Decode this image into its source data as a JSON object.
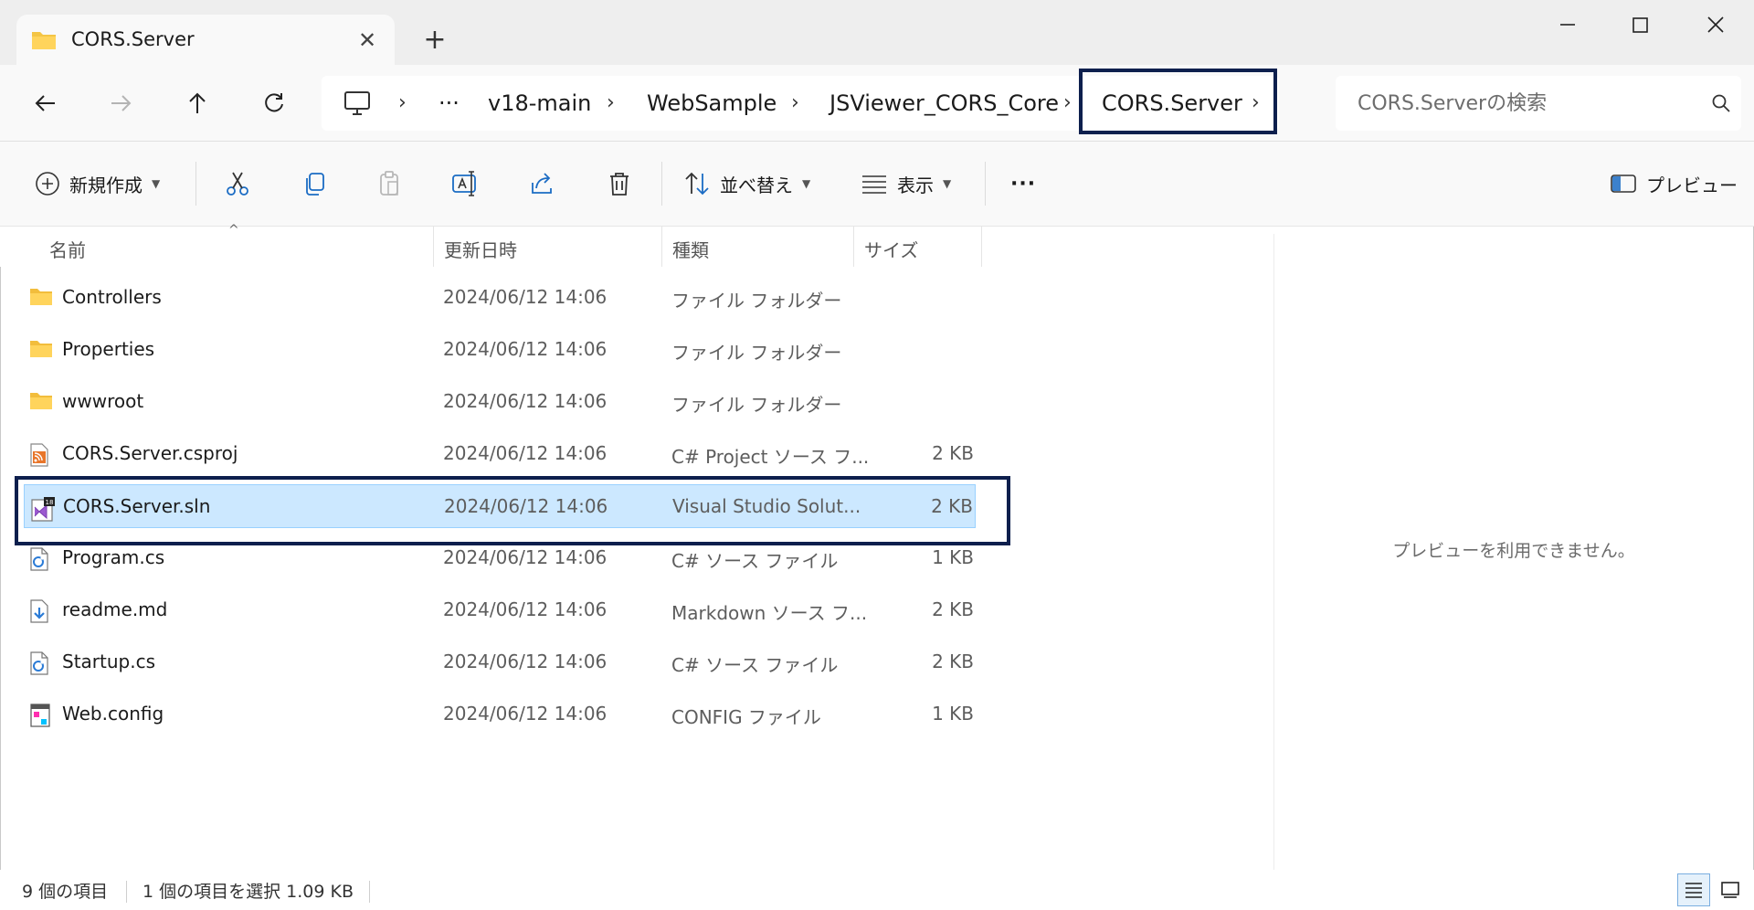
{
  "tab": {
    "title": "CORS.Server",
    "close": "✕",
    "new": "+"
  },
  "address": {
    "overflow": "···",
    "crumbs": [
      "v18-main",
      "WebSample",
      "JSViewer_CORS_Core",
      "CORS.Server"
    ],
    "separator": "›"
  },
  "search": {
    "placeholder": "CORS.Serverの検索"
  },
  "commands": {
    "new": "新規作成",
    "sort": "並べ替え",
    "view": "表示",
    "more": "···",
    "preview": "プレビュー"
  },
  "columns": {
    "name": "名前",
    "date": "更新日時",
    "type": "種類",
    "size": "サイズ",
    "sort_indicator": "^"
  },
  "files": [
    {
      "name": "Controllers",
      "date": "2024/06/12 14:06",
      "type": "ファイル フォルダー",
      "size": "",
      "icon": "folder-icon"
    },
    {
      "name": "Properties",
      "date": "2024/06/12 14:06",
      "type": "ファイル フォルダー",
      "size": "",
      "icon": "folder-icon"
    },
    {
      "name": "wwwroot",
      "date": "2024/06/12 14:06",
      "type": "ファイル フォルダー",
      "size": "",
      "icon": "folder-icon"
    },
    {
      "name": "CORS.Server.csproj",
      "date": "2024/06/12 14:06",
      "type": "C# Project ソース フ...",
      "size": "2 KB",
      "icon": "rss-file-icon"
    },
    {
      "name": "CORS.Server.sln",
      "date": "2024/06/12 14:06",
      "type": "Visual Studio Solut...",
      "size": "2 KB",
      "icon": "visual-studio-solution-icon"
    },
    {
      "name": "Program.cs",
      "date": "2024/06/12 14:06",
      "type": "C# ソース ファイル",
      "size": "1 KB",
      "icon": "csharp-file-icon"
    },
    {
      "name": "readme.md",
      "date": "2024/06/12 14:06",
      "type": "Markdown ソース フ...",
      "size": "2 KB",
      "icon": "markdown-file-icon"
    },
    {
      "name": "Startup.cs",
      "date": "2024/06/12 14:06",
      "type": "C# ソース ファイル",
      "size": "2 KB",
      "icon": "csharp-file-icon"
    },
    {
      "name": "Web.config",
      "date": "2024/06/12 14:06",
      "type": "CONFIG ファイル",
      "size": "1 KB",
      "icon": "config-file-icon"
    }
  ],
  "selected_index": 4,
  "preview": {
    "message": "プレビューを利用できません。"
  },
  "status": {
    "count": "9 個の項目",
    "selection": "1 個の項目を選択  1.09 KB"
  },
  "colors": {
    "highlight_border": "#0d1f4d",
    "selection_bg": "#cce8ff",
    "folder": "#f4c545"
  }
}
